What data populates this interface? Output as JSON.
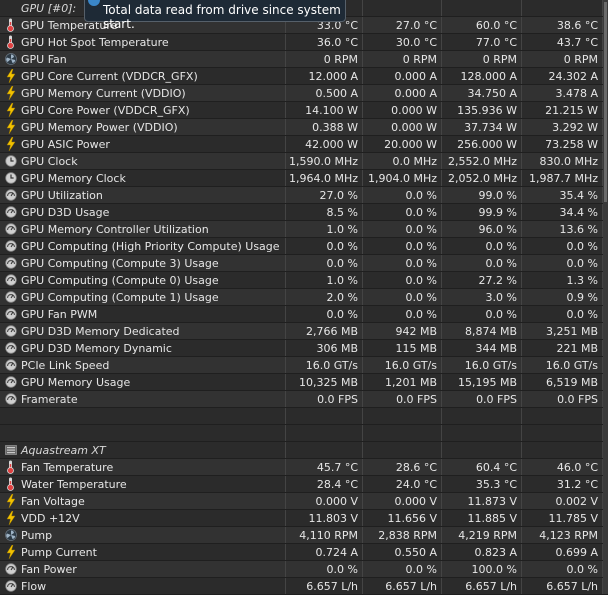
{
  "tooltip": {
    "text": "Total data read from drive since system start."
  },
  "rows": [
    {
      "kind": "section",
      "name": "GPU [#0]: ",
      "icon": "none"
    },
    {
      "kind": "data",
      "icon": "thermometer-icon",
      "name": "GPU Temperature",
      "v": [
        "33.0 °C",
        "27.0 °C",
        "60.0 °C",
        "38.6 °C"
      ]
    },
    {
      "kind": "data",
      "icon": "thermometer-icon",
      "name": "GPU Hot Spot Temperature",
      "v": [
        "36.0 °C",
        "30.0 °C",
        "77.0 °C",
        "43.7 °C"
      ]
    },
    {
      "kind": "data",
      "icon": "fan-icon",
      "name": "GPU Fan",
      "v": [
        "0 RPM",
        "0 RPM",
        "0 RPM",
        "0 RPM"
      ]
    },
    {
      "kind": "data",
      "icon": "lightning-icon",
      "name": "GPU Core Current (VDDCR_GFX)",
      "v": [
        "12.000 A",
        "0.000 A",
        "128.000 A",
        "24.302 A"
      ]
    },
    {
      "kind": "data",
      "icon": "lightning-icon",
      "name": "GPU Memory Current (VDDIO)",
      "v": [
        "0.500 A",
        "0.000 A",
        "34.750 A",
        "3.478 A"
      ]
    },
    {
      "kind": "data",
      "icon": "lightning-icon",
      "name": "GPU Core Power (VDDCR_GFX)",
      "v": [
        "14.100 W",
        "0.000 W",
        "135.936 W",
        "21.215 W"
      ]
    },
    {
      "kind": "data",
      "icon": "lightning-icon",
      "name": "GPU Memory Power (VDDIO)",
      "v": [
        "0.388 W",
        "0.000 W",
        "37.734 W",
        "3.292 W"
      ]
    },
    {
      "kind": "data",
      "icon": "lightning-icon",
      "name": "GPU ASIC Power",
      "v": [
        "42.000 W",
        "20.000 W",
        "256.000 W",
        "73.258 W"
      ]
    },
    {
      "kind": "data",
      "icon": "clock-icon",
      "name": "GPU Clock",
      "v": [
        "1,590.0 MHz",
        "0.0 MHz",
        "2,552.0 MHz",
        "830.0 MHz"
      ]
    },
    {
      "kind": "data",
      "icon": "clock-icon",
      "name": "GPU Memory Clock",
      "v": [
        "1,964.0 MHz",
        "1,904.0 MHz",
        "2,052.0 MHz",
        "1,987.7 MHz"
      ]
    },
    {
      "kind": "data",
      "icon": "gauge-icon",
      "name": "GPU Utilization",
      "v": [
        "27.0 %",
        "0.0 %",
        "99.0 %",
        "35.4 %"
      ]
    },
    {
      "kind": "data",
      "icon": "gauge-icon",
      "name": "GPU D3D Usage",
      "v": [
        "8.5 %",
        "0.0 %",
        "99.9 %",
        "34.4 %"
      ]
    },
    {
      "kind": "data",
      "icon": "gauge-icon",
      "name": "GPU Memory Controller Utilization",
      "v": [
        "1.0 %",
        "0.0 %",
        "96.0 %",
        "13.6 %"
      ]
    },
    {
      "kind": "data",
      "icon": "gauge-icon",
      "name": "GPU Computing (High Priority Compute) Usage",
      "v": [
        "0.0 %",
        "0.0 %",
        "0.0 %",
        "0.0 %"
      ]
    },
    {
      "kind": "data",
      "icon": "gauge-icon",
      "name": "GPU Computing (Compute 3) Usage",
      "v": [
        "0.0 %",
        "0.0 %",
        "0.0 %",
        "0.0 %"
      ]
    },
    {
      "kind": "data",
      "icon": "gauge-icon",
      "name": "GPU Computing (Compute 0) Usage",
      "v": [
        "1.0 %",
        "0.0 %",
        "27.2 %",
        "1.3 %"
      ]
    },
    {
      "kind": "data",
      "icon": "gauge-icon",
      "name": "GPU Computing (Compute 1) Usage",
      "v": [
        "2.0 %",
        "0.0 %",
        "3.0 %",
        "0.9 %"
      ]
    },
    {
      "kind": "data",
      "icon": "gauge-icon",
      "name": "GPU Fan PWM",
      "v": [
        "0.0 %",
        "0.0 %",
        "0.0 %",
        "0.0 %"
      ]
    },
    {
      "kind": "data",
      "icon": "gauge-icon",
      "name": "GPU D3D Memory Dedicated",
      "v": [
        "2,766 MB",
        "942 MB",
        "8,874 MB",
        "3,251 MB"
      ]
    },
    {
      "kind": "data",
      "icon": "gauge-icon",
      "name": "GPU D3D Memory Dynamic",
      "v": [
        "306 MB",
        "115 MB",
        "344 MB",
        "221 MB"
      ]
    },
    {
      "kind": "data",
      "icon": "gauge-icon",
      "name": "PCIe Link Speed",
      "v": [
        "16.0 GT/s",
        "16.0 GT/s",
        "16.0 GT/s",
        "16.0 GT/s"
      ]
    },
    {
      "kind": "data",
      "icon": "gauge-icon",
      "name": "GPU Memory Usage",
      "v": [
        "10,325 MB",
        "1,201 MB",
        "15,195 MB",
        "6,519 MB"
      ]
    },
    {
      "kind": "data",
      "icon": "gauge-icon",
      "name": "Framerate",
      "v": [
        "0.0 FPS",
        "0.0 FPS",
        "0.0 FPS",
        "0.0 FPS"
      ]
    },
    {
      "kind": "blank",
      "name": "",
      "icon": "none"
    },
    {
      "kind": "blank",
      "name": "",
      "icon": "none"
    },
    {
      "kind": "section",
      "name": "Aquastream XT",
      "icon": "device-icon"
    },
    {
      "kind": "data",
      "icon": "thermometer-icon",
      "name": "Fan Temperature",
      "v": [
        "45.7 °C",
        "28.6 °C",
        "60.4 °C",
        "46.0 °C"
      ]
    },
    {
      "kind": "data",
      "icon": "thermometer-icon",
      "name": "Water Temperature",
      "v": [
        "28.4 °C",
        "24.0 °C",
        "35.3 °C",
        "31.2 °C"
      ]
    },
    {
      "kind": "data",
      "icon": "lightning-icon",
      "name": "Fan Voltage",
      "v": [
        "0.000 V",
        "0.000 V",
        "11.873 V",
        "0.002 V"
      ]
    },
    {
      "kind": "data",
      "icon": "lightning-icon",
      "name": "VDD +12V",
      "v": [
        "11.803 V",
        "11.656 V",
        "11.885 V",
        "11.785 V"
      ]
    },
    {
      "kind": "data",
      "icon": "fan-icon",
      "name": "Pump",
      "v": [
        "4,110 RPM",
        "2,838 RPM",
        "4,219 RPM",
        "4,123 RPM"
      ]
    },
    {
      "kind": "data",
      "icon": "lightning-icon",
      "name": "Pump Current",
      "v": [
        "0.724 A",
        "0.550 A",
        "0.823 A",
        "0.699 A"
      ]
    },
    {
      "kind": "data",
      "icon": "gauge-icon",
      "name": "Fan Power",
      "v": [
        "0.0 %",
        "0.0 %",
        "100.0 %",
        "0.0 %"
      ]
    },
    {
      "kind": "data",
      "icon": "gauge-icon",
      "name": "Flow",
      "v": [
        "6.657 L/h",
        "6.657 L/h",
        "6.657 L/h",
        "6.657 L/h"
      ]
    }
  ]
}
